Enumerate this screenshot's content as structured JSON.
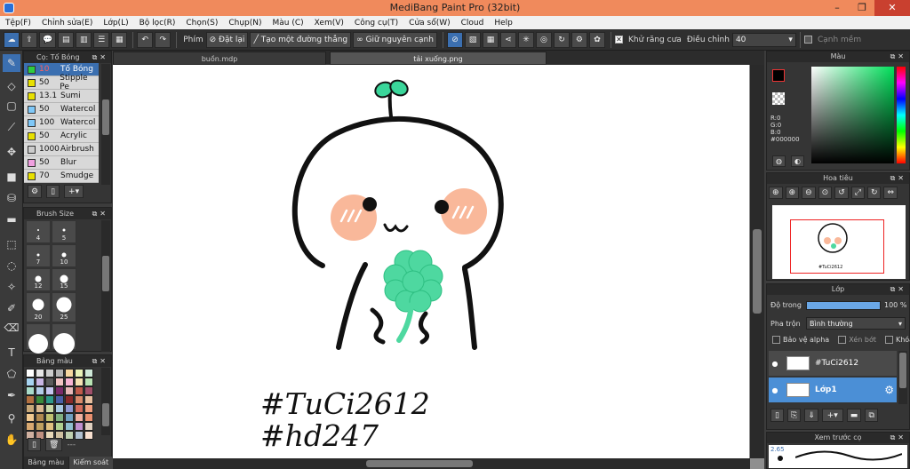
{
  "window": {
    "title": "MediBang Paint Pro (32bit)",
    "controls": [
      "–",
      "❐",
      "✕"
    ]
  },
  "menu": [
    "Tệp(F)",
    "Chỉnh sửa(E)",
    "Lớp(L)",
    "Bộ lọc(R)",
    "Chọn(S)",
    "Chụp(N)",
    "Màu (C)",
    "Xem(V)",
    "Công cụ(T)",
    "Cửa sổ(W)",
    "Cloud",
    "Help"
  ],
  "toolbar": {
    "phim_label": "Phím",
    "reset_label": "Đặt lại",
    "line_label": "Tạo một đường thẳng",
    "keep_label": "Giữ nguyên cạnh",
    "antialias_label": "Khử răng cưa",
    "adjust_label": "Điều chỉnh",
    "adjust_value": "40",
    "edge_label": "Cạnh mềm"
  },
  "brush_panel": {
    "title": "Cọ: Tố Bóng",
    "items": [
      {
        "size": "10",
        "name": "Tố Bóng",
        "color": "#2ecc40",
        "selected": true
      },
      {
        "size": "50",
        "name": "Stipple Pe",
        "color": "#e8e000"
      },
      {
        "size": "13.1",
        "name": "Sumi",
        "color": "#e8e000"
      },
      {
        "size": "50",
        "name": "Watercol",
        "color": "#7fc8f8"
      },
      {
        "size": "100",
        "name": "Watercol",
        "color": "#7fc8f8"
      },
      {
        "size": "50",
        "name": "Acrylic",
        "color": "#e8e000"
      },
      {
        "size": "1000",
        "name": "Airbrush",
        "color": "#cccccc"
      },
      {
        "size": "50",
        "name": "Blur",
        "color": "#f0a0e0"
      },
      {
        "size": "70",
        "name": "Smudge",
        "color": "#e8e000"
      }
    ]
  },
  "brush_size_panel": {
    "title": "Brush Size",
    "sizes": [
      "4",
      "5",
      "7",
      "10",
      "12",
      "15",
      "20",
      "25"
    ]
  },
  "palette_panel": {
    "title": "Bảng màu",
    "tabs": [
      "Bảng màu",
      "Kiểm soát cọ"
    ],
    "footer_text": "---"
  },
  "doc_tabs": [
    "buồn.mdp",
    "tải xuống.png"
  ],
  "canvas_text": {
    "tag1": "#TuCi2612",
    "tag2": "#hd247"
  },
  "color_panel": {
    "title": "Màu",
    "rgb": [
      "R:0",
      "G:0",
      "B:0"
    ],
    "hex": "#000000",
    "primary": "#000000",
    "secondary": "#ffffff"
  },
  "navigator_panel": {
    "title": "Hoa tiêu"
  },
  "layer_panel": {
    "title": "Lớp",
    "opacity_label": "Độ trong",
    "opacity_value": "100 %",
    "opacity_fraction": 1.0,
    "blend_label": "Pha trộn",
    "blend_value": "Bình thường",
    "protect_alpha": "Bảo vệ alpha",
    "clipping": "Xén bớt",
    "lock": "Khóa",
    "layers": [
      {
        "name": "#TuCi2612",
        "selected": false
      },
      {
        "name": "Lớp1",
        "selected": true
      }
    ]
  },
  "preview_panel": {
    "title": "Xem trước cọ",
    "value": "2.65"
  },
  "colors": {
    "accent": "#3b6fb0",
    "titlebar": "#f08a5c",
    "panel": "#353535",
    "clover": "#4ed8a0",
    "sprout": "#3ad69a",
    "cheek": "#f9b89a"
  }
}
